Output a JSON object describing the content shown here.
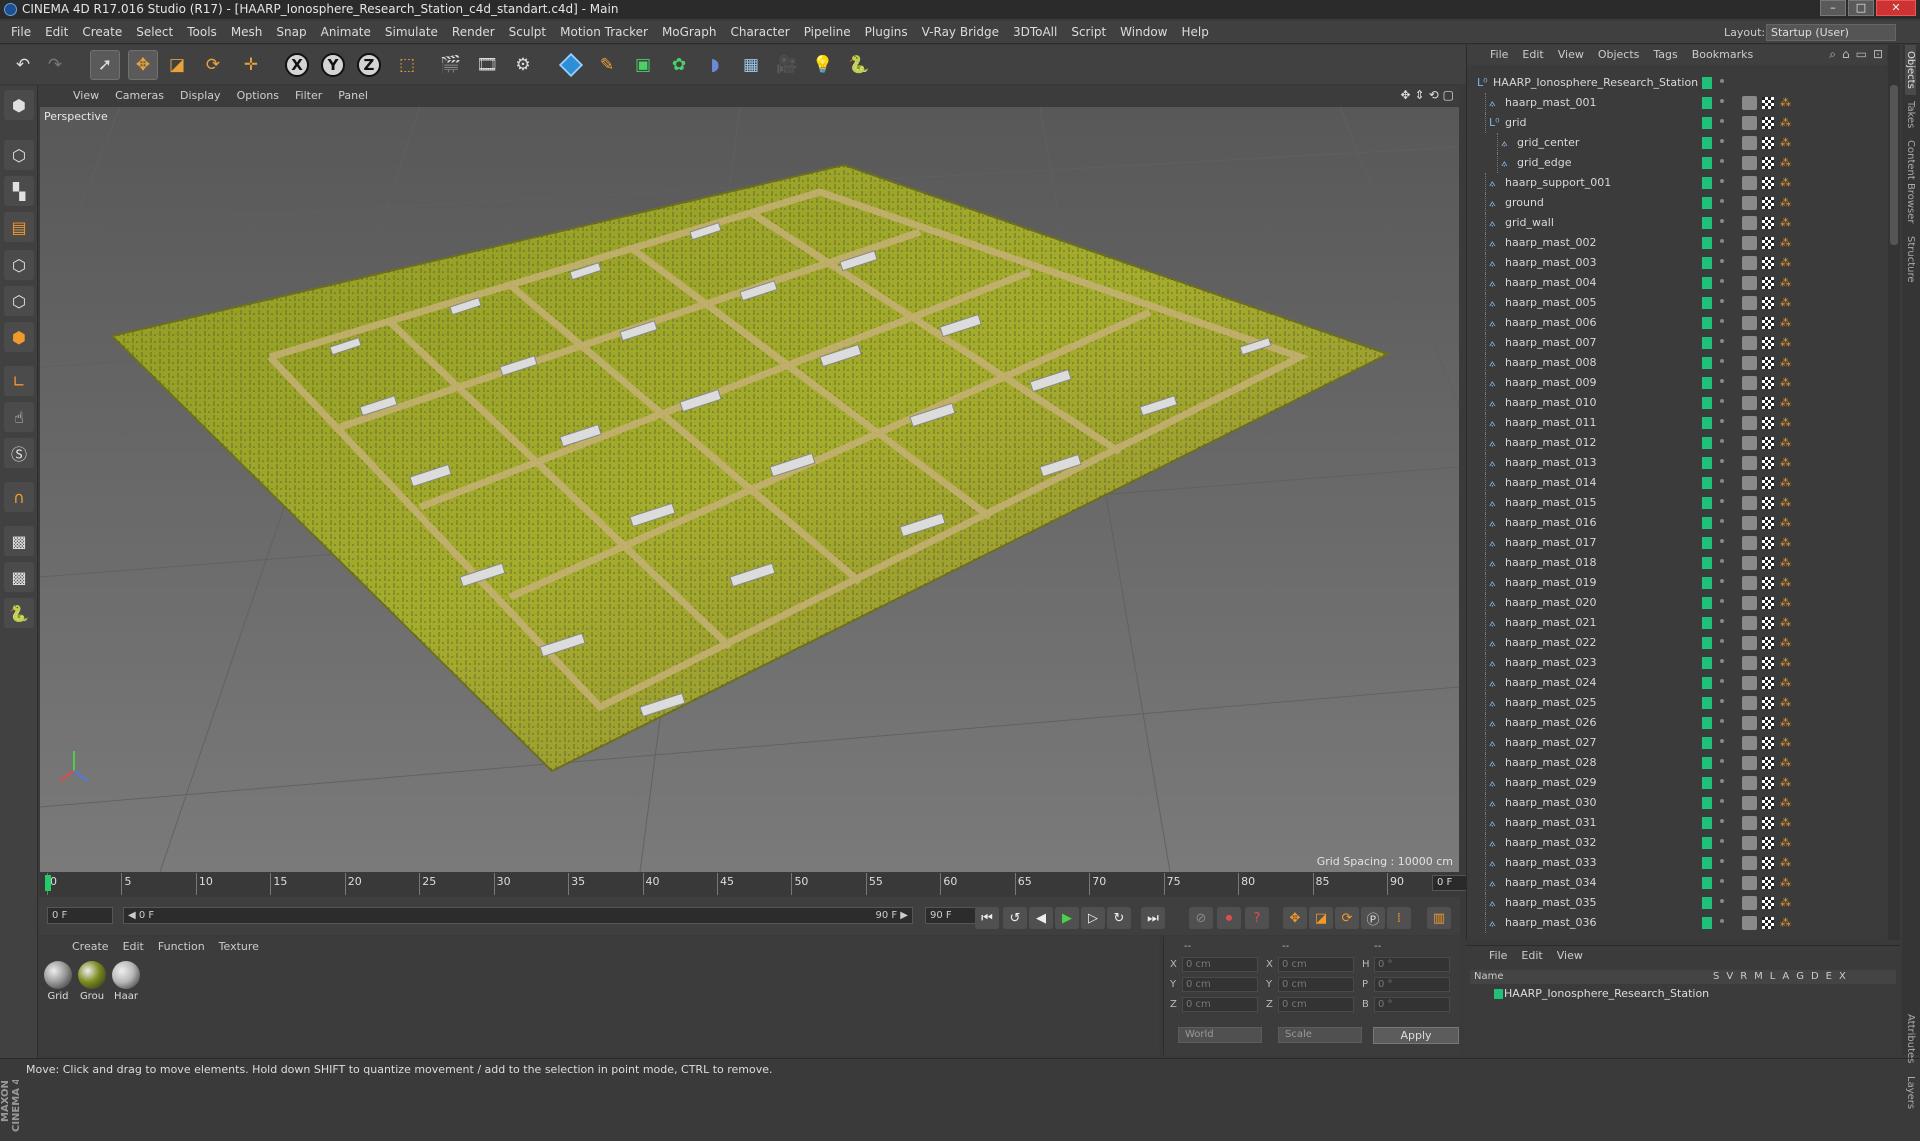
{
  "window": {
    "title": "CINEMA 4D R17.016 Studio (R17) - [HAARP_Ionosphere_Research_Station_c4d_standart.c4d] - Main",
    "buttons": [
      "–",
      "□",
      "✕"
    ]
  },
  "menubar": {
    "items": [
      "File",
      "Edit",
      "Create",
      "Select",
      "Tools",
      "Mesh",
      "Snap",
      "Animate",
      "Simulate",
      "Render",
      "Sculpt",
      "Motion Tracker",
      "MoGraph",
      "Character",
      "Pipeline",
      "Plugins",
      "V-Ray Bridge",
      "3DToAll",
      "Script",
      "Window",
      "Help"
    ],
    "layout_label": "Layout:",
    "layout_value": "Startup (User)"
  },
  "toolbar": {
    "axis_x": "X",
    "axis_y": "Y",
    "axis_z": "Z"
  },
  "viewport": {
    "menu": [
      "View",
      "Cameras",
      "Display",
      "Options",
      "Filter",
      "Panel"
    ],
    "label": "Perspective",
    "grid_spacing": "Grid Spacing : 10000 cm"
  },
  "timeline": {
    "ticks": [
      "0",
      "5",
      "10",
      "15",
      "20",
      "25",
      "30",
      "35",
      "40",
      "45",
      "50",
      "55",
      "60",
      "65",
      "70",
      "75",
      "80",
      "85",
      "90"
    ],
    "current_frame": "0 F",
    "start_field": "0 F",
    "range_start": "◀ 0 F",
    "range_end": "90 F ▶",
    "end_field": "90 F"
  },
  "materials": {
    "menu": [
      "Create",
      "Edit",
      "Function",
      "Texture"
    ],
    "items": [
      {
        "name": "Grid",
        "color": "#9a9a9a"
      },
      {
        "name": "Grou",
        "color": "#7c8a1e"
      },
      {
        "name": "Haar",
        "color": "#b8b8b8"
      }
    ]
  },
  "coords": {
    "header": [
      "--",
      "--",
      "--"
    ],
    "rows": [
      {
        "a": "X",
        "av": "0 cm",
        "b": "X",
        "bv": "0 cm",
        "c": "H",
        "cv": "0 °"
      },
      {
        "a": "Y",
        "av": "0 cm",
        "b": "Y",
        "bv": "0 cm",
        "c": "P",
        "cv": "0 °"
      },
      {
        "a": "Z",
        "av": "0 cm",
        "b": "Z",
        "bv": "0 cm",
        "c": "B",
        "cv": "0 °"
      }
    ],
    "mode1": "World",
    "mode2": "Scale",
    "apply": "Apply"
  },
  "status": "Move: Click and drag to move elements. Hold down SHIFT to quantize movement / add to the selection in point mode, CTRL to remove.",
  "object_manager": {
    "menu": [
      "File",
      "Edit",
      "View",
      "Objects",
      "Tags",
      "Bookmarks"
    ],
    "objects": [
      {
        "name": "HAARP_Ionosphere_Research_Station",
        "level": 0,
        "type": "null"
      },
      {
        "name": "haarp_mast_001",
        "level": 1,
        "type": "obj"
      },
      {
        "name": "grid",
        "level": 1,
        "type": "null"
      },
      {
        "name": "grid_center",
        "level": 2,
        "type": "obj"
      },
      {
        "name": "grid_edge",
        "level": 2,
        "type": "obj"
      },
      {
        "name": "haarp_support_001",
        "level": 1,
        "type": "obj"
      },
      {
        "name": "ground",
        "level": 1,
        "type": "obj"
      },
      {
        "name": "grid_wall",
        "level": 1,
        "type": "obj"
      },
      {
        "name": "haarp_mast_002",
        "level": 1,
        "type": "obj"
      },
      {
        "name": "haarp_mast_003",
        "level": 1,
        "type": "obj"
      },
      {
        "name": "haarp_mast_004",
        "level": 1,
        "type": "obj"
      },
      {
        "name": "haarp_mast_005",
        "level": 1,
        "type": "obj"
      },
      {
        "name": "haarp_mast_006",
        "level": 1,
        "type": "obj"
      },
      {
        "name": "haarp_mast_007",
        "level": 1,
        "type": "obj"
      },
      {
        "name": "haarp_mast_008",
        "level": 1,
        "type": "obj"
      },
      {
        "name": "haarp_mast_009",
        "level": 1,
        "type": "obj"
      },
      {
        "name": "haarp_mast_010",
        "level": 1,
        "type": "obj"
      },
      {
        "name": "haarp_mast_011",
        "level": 1,
        "type": "obj"
      },
      {
        "name": "haarp_mast_012",
        "level": 1,
        "type": "obj"
      },
      {
        "name": "haarp_mast_013",
        "level": 1,
        "type": "obj"
      },
      {
        "name": "haarp_mast_014",
        "level": 1,
        "type": "obj"
      },
      {
        "name": "haarp_mast_015",
        "level": 1,
        "type": "obj"
      },
      {
        "name": "haarp_mast_016",
        "level": 1,
        "type": "obj"
      },
      {
        "name": "haarp_mast_017",
        "level": 1,
        "type": "obj"
      },
      {
        "name": "haarp_mast_018",
        "level": 1,
        "type": "obj"
      },
      {
        "name": "haarp_mast_019",
        "level": 1,
        "type": "obj"
      },
      {
        "name": "haarp_mast_020",
        "level": 1,
        "type": "obj"
      },
      {
        "name": "haarp_mast_021",
        "level": 1,
        "type": "obj"
      },
      {
        "name": "haarp_mast_022",
        "level": 1,
        "type": "obj"
      },
      {
        "name": "haarp_mast_023",
        "level": 1,
        "type": "obj"
      },
      {
        "name": "haarp_mast_024",
        "level": 1,
        "type": "obj"
      },
      {
        "name": "haarp_mast_025",
        "level": 1,
        "type": "obj"
      },
      {
        "name": "haarp_mast_026",
        "level": 1,
        "type": "obj"
      },
      {
        "name": "haarp_mast_027",
        "level": 1,
        "type": "obj"
      },
      {
        "name": "haarp_mast_028",
        "level": 1,
        "type": "obj"
      },
      {
        "name": "haarp_mast_029",
        "level": 1,
        "type": "obj"
      },
      {
        "name": "haarp_mast_030",
        "level": 1,
        "type": "obj"
      },
      {
        "name": "haarp_mast_031",
        "level": 1,
        "type": "obj"
      },
      {
        "name": "haarp_mast_032",
        "level": 1,
        "type": "obj"
      },
      {
        "name": "haarp_mast_033",
        "level": 1,
        "type": "obj"
      },
      {
        "name": "haarp_mast_034",
        "level": 1,
        "type": "obj"
      },
      {
        "name": "haarp_mast_035",
        "level": 1,
        "type": "obj"
      },
      {
        "name": "haarp_mast_036",
        "level": 1,
        "type": "obj"
      }
    ]
  },
  "layers": {
    "menu": [
      "File",
      "Edit",
      "View"
    ],
    "header_name": "Name",
    "columns": [
      "S",
      "V",
      "R",
      "M",
      "L",
      "A",
      "G",
      "D",
      "E",
      "X"
    ],
    "rows": [
      "HAARP_Ionosphere_Research_Station"
    ]
  },
  "side_tabs": [
    "Objects",
    "Takes",
    "Content Browser",
    "Structure",
    "Attributes",
    "Layers"
  ],
  "brand": "MAXON CINEMA 4D",
  "colors": {
    "accent_green": "#1fc07a",
    "tool_orange": "#ef9a2b",
    "ground_green": "#8fa02a"
  }
}
